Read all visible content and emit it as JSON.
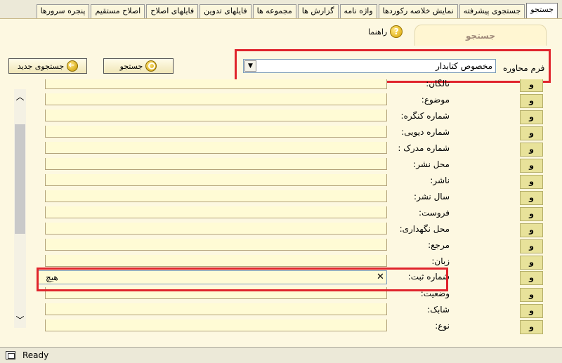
{
  "tabs": [
    {
      "label": "جستجو",
      "active": true
    },
    {
      "label": "جستجوی پیشرفته",
      "active": false
    },
    {
      "label": "نمایش خلاصه رکوردها",
      "active": false
    },
    {
      "label": "واژه نامه",
      "active": false
    },
    {
      "label": "گزارش ها",
      "active": false
    },
    {
      "label": "مجموعه ها",
      "active": false
    },
    {
      "label": "فایلهای تدوین",
      "active": false
    },
    {
      "label": "فایلهای اصلاح",
      "active": false
    },
    {
      "label": "اصلاح مستقیم",
      "active": false
    },
    {
      "label": "پنجره سرورها",
      "active": false
    }
  ],
  "panel": {
    "inner_tab": "جستجو",
    "help_label": "راهنما"
  },
  "toolbar": {
    "search_label": "جستجو",
    "new_search_label": "جستجوی جدید"
  },
  "form": {
    "label": "فرم محاوره",
    "selected": "مخصوص کتابدار"
  },
  "rows": [
    {
      "label": "تالگان:",
      "op": "و",
      "value": ""
    },
    {
      "label": "موضوع:",
      "op": "و",
      "value": ""
    },
    {
      "label": "شماره کنگره:",
      "op": "و",
      "value": ""
    },
    {
      "label": "شماره دیویی:",
      "op": "و",
      "value": ""
    },
    {
      "label": "شماره مدرک :",
      "op": "و",
      "value": ""
    },
    {
      "label": "محل نشر:",
      "op": "و",
      "value": ""
    },
    {
      "label": "ناشر:",
      "op": "و",
      "value": ""
    },
    {
      "label": "سال نشر:",
      "op": "و",
      "value": ""
    },
    {
      "label": "فروست:",
      "op": "و",
      "value": ""
    },
    {
      "label": "محل نگهداری:",
      "op": "و",
      "value": ""
    },
    {
      "label": "مرجع:",
      "op": "و",
      "value": ""
    },
    {
      "label": "زبان:",
      "op": "و",
      "value": ""
    },
    {
      "label": "شماره ثبت:",
      "op": "و",
      "value": "هیچ"
    },
    {
      "label": "وضعیت:",
      "op": "و",
      "value": ""
    },
    {
      "label": "شابک:",
      "op": "و",
      "value": ""
    },
    {
      "label": "نوع:",
      "op": "و",
      "value": ""
    }
  ],
  "status": {
    "text": "Ready"
  },
  "colors": {
    "highlight": "#e0242c",
    "field_bg": "#fffbd5",
    "op_bg": "#e8e29a"
  }
}
